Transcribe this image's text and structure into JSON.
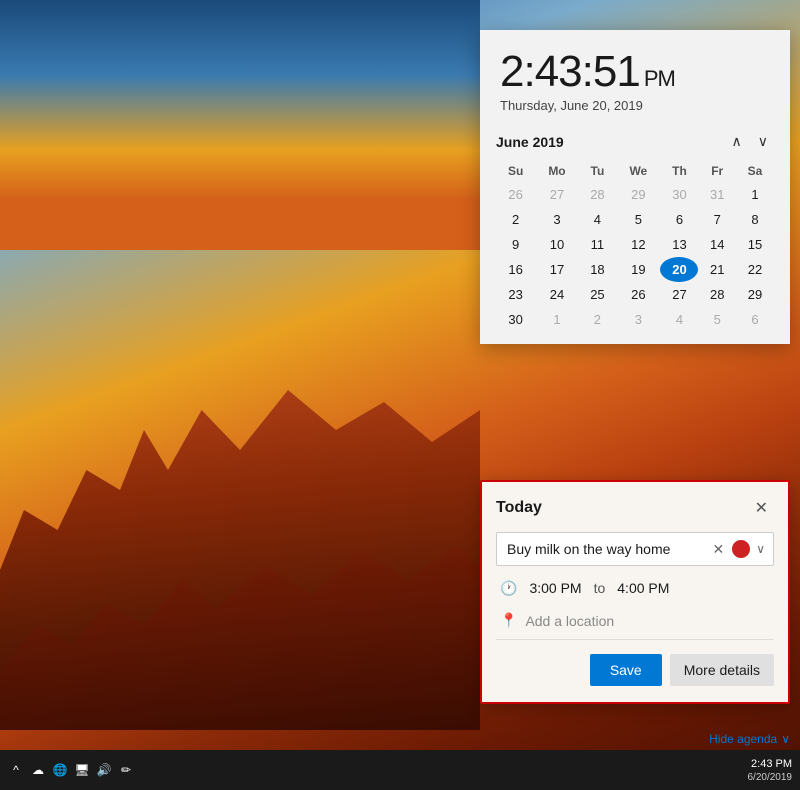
{
  "background": {
    "alt": "Grand Canyon sunset landscape"
  },
  "clock": {
    "time": "2:43:51",
    "ampm": "PM",
    "date": "Thursday, June 20, 2019"
  },
  "calendar": {
    "month_year": "June 2019",
    "nav_up": "∧",
    "nav_down": "∨",
    "weekdays": [
      "Su",
      "Mo",
      "Tu",
      "We",
      "Th",
      "Fr",
      "Sa"
    ],
    "weeks": [
      [
        {
          "day": "26",
          "other": true
        },
        {
          "day": "27",
          "other": true
        },
        {
          "day": "28",
          "other": true
        },
        {
          "day": "29",
          "other": true
        },
        {
          "day": "30",
          "other": true
        },
        {
          "day": "31",
          "other": true
        },
        {
          "day": "1",
          "other": false
        }
      ],
      [
        {
          "day": "2"
        },
        {
          "day": "3"
        },
        {
          "day": "4"
        },
        {
          "day": "5"
        },
        {
          "day": "6"
        },
        {
          "day": "7"
        },
        {
          "day": "8"
        }
      ],
      [
        {
          "day": "9"
        },
        {
          "day": "10"
        },
        {
          "day": "11"
        },
        {
          "day": "12"
        },
        {
          "day": "13"
        },
        {
          "day": "14"
        },
        {
          "day": "15"
        }
      ],
      [
        {
          "day": "16"
        },
        {
          "day": "17"
        },
        {
          "day": "18"
        },
        {
          "day": "19"
        },
        {
          "day": "20",
          "today": true
        },
        {
          "day": "21"
        },
        {
          "day": "22"
        }
      ],
      [
        {
          "day": "23"
        },
        {
          "day": "24"
        },
        {
          "day": "25"
        },
        {
          "day": "26"
        },
        {
          "day": "27"
        },
        {
          "day": "28"
        },
        {
          "day": "29"
        }
      ],
      [
        {
          "day": "30"
        },
        {
          "day": "1",
          "other": true
        },
        {
          "day": "2",
          "other": true
        },
        {
          "day": "3",
          "other": true
        },
        {
          "day": "4",
          "other": true
        },
        {
          "day": "5",
          "other": true
        },
        {
          "day": "6",
          "other": true
        }
      ]
    ]
  },
  "event_popup": {
    "title": "Today",
    "close_label": "✕",
    "event_title": "Buy milk on the way home",
    "clear_label": "✕",
    "color": "#cc2222",
    "time_start": "3:00 PM",
    "time_to": "to",
    "time_end": "4:00 PM",
    "location_placeholder": "Add a location",
    "save_label": "Save",
    "more_details_label": "More details"
  },
  "hide_agenda": {
    "label": "Hide agenda",
    "chevron": "∨"
  },
  "taskbar": {
    "time": "2:43 PM",
    "date": "6/20/2019",
    "icons": {
      "chevron": "^",
      "cloud": "☁",
      "wifi": "🌐",
      "desktop": "🖥",
      "volume": "🔊",
      "pen": "✏"
    }
  }
}
